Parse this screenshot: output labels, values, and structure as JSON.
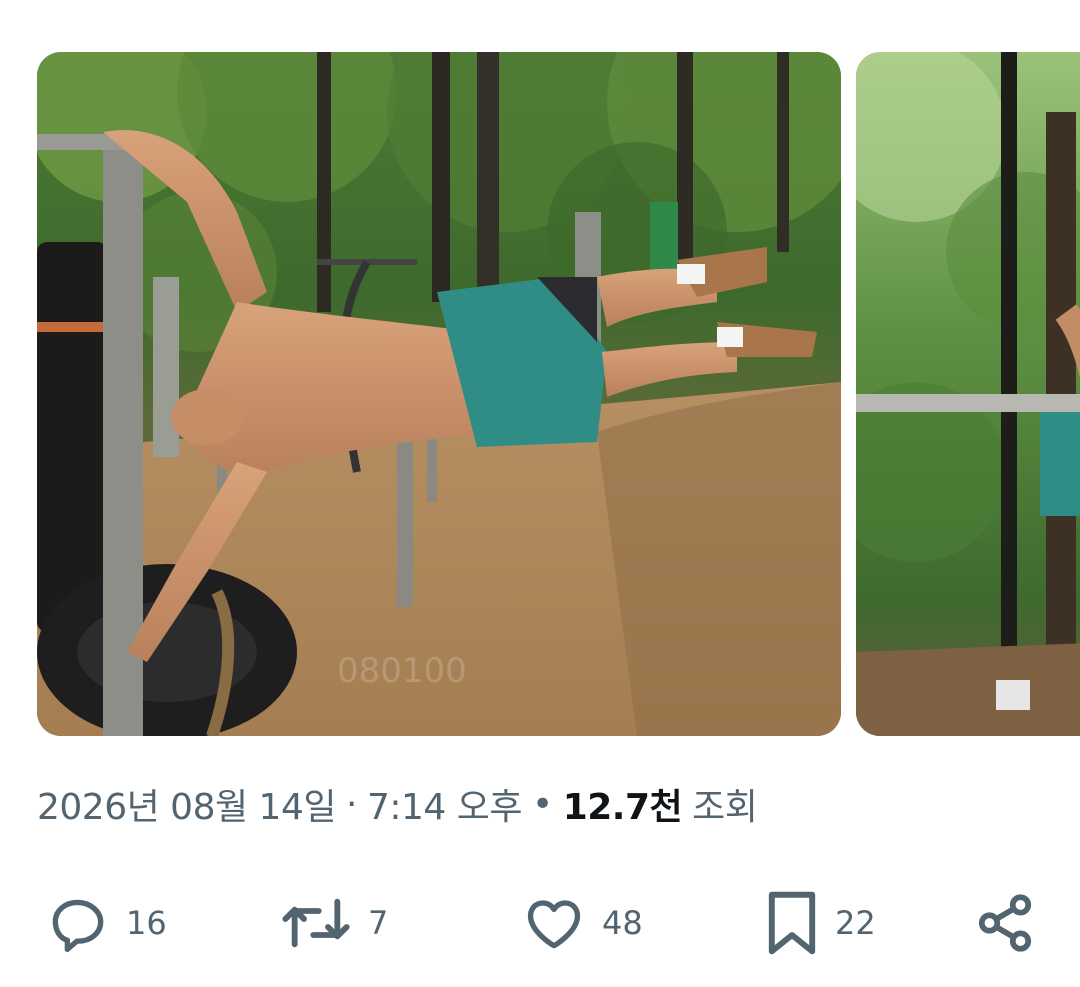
{
  "media": {
    "images": [
      {
        "icon": "photo-calisthenics-human-flag",
        "watermark": "080100"
      },
      {
        "icon": "photo-calisthenics-bar-forest"
      }
    ]
  },
  "meta": {
    "date": "2026년 08월 14일",
    "separator": "·",
    "time": "7:14 오후",
    "dot": "•",
    "views_count": "12.7천",
    "views_label": "조회"
  },
  "actions": {
    "reply": {
      "icon": "reply-icon",
      "count": "16"
    },
    "retweet": {
      "icon": "retweet-icon",
      "count": "7"
    },
    "like": {
      "icon": "heart-icon",
      "count": "48"
    },
    "bookmark": {
      "icon": "bookmark-icon",
      "count": "22"
    },
    "share": {
      "icon": "share-icon"
    }
  },
  "colors": {
    "text_secondary": "#536471",
    "text_primary": "#0f1419",
    "background": "#ffffff"
  }
}
